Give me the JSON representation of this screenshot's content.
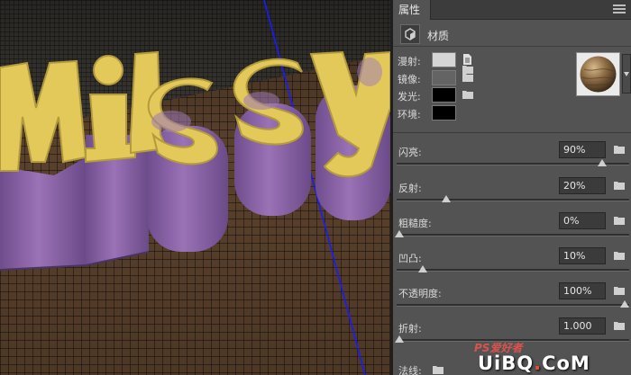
{
  "panel": {
    "tab_title": "属性",
    "material_label": "材质",
    "textures": [
      {
        "label": "漫射:",
        "color": "#d6d6d6",
        "has_doc": true
      },
      {
        "label": "镜像:",
        "color": "#646464",
        "has_doc": false
      },
      {
        "label": "发光:",
        "color": "#000000",
        "has_doc": false
      },
      {
        "label": "环境:",
        "color": "#000000",
        "has_doc": false
      }
    ],
    "properties": [
      {
        "label": "闪亮:",
        "value": "90%",
        "slider": 0.9
      },
      {
        "label": "反射:",
        "value": "20%",
        "slider": 0.2
      },
      {
        "label": "粗糙度:",
        "value": "0%",
        "slider": 0.0
      },
      {
        "label": "凹凸:",
        "value": "10%",
        "slider": 0.1
      },
      {
        "label": "不透明度:",
        "value": "100%",
        "slider": 1.0
      },
      {
        "label": "折射:",
        "value": "1.000",
        "slider": 0.0
      }
    ],
    "bottom_label": "法线:"
  },
  "scene": {
    "text": "Missy",
    "face_color": "#e3c85a",
    "side_color": "#8c63a8",
    "grid_line_color": "#1b140e",
    "axis_color": "#1a1aff"
  },
  "watermark": {
    "line1": "PS爱好者",
    "line2_a": "UiBQ",
    "line2_dot": ".",
    "line2_b": "CoM"
  }
}
